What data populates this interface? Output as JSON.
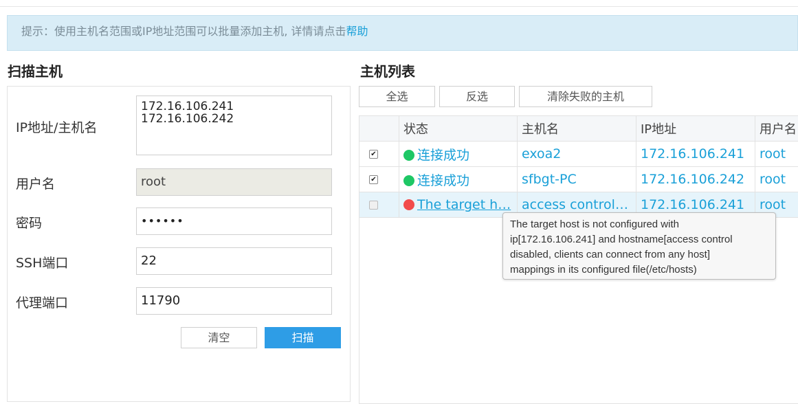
{
  "tip": {
    "text": "提示：使用主机名范围或IP地址范围可以批量添加主机, 详情请点击",
    "link": "帮助"
  },
  "scan": {
    "title": "扫描主机",
    "ip_label": "IP地址/主机名",
    "ip_value": "172.16.106.241\n172.16.106.242",
    "user_label": "用户名",
    "user_value": "root",
    "password_label": "密码",
    "password_value": "••••••",
    "ssh_label": "SSH端口",
    "ssh_value": "22",
    "proxy_label": "代理端口",
    "proxy_value": "11790",
    "clear_button": "清空",
    "scan_button": "扫描"
  },
  "hostlist": {
    "title": "主机列表",
    "select_all": "全选",
    "invert": "反选",
    "clear_failed": "清除失败的主机",
    "columns": [
      "状态",
      "主机名",
      "IP地址",
      "用户名"
    ],
    "rows": [
      {
        "checked": true,
        "status": "连接成功",
        "status_color": "#1ec765",
        "hostname": "exoa2",
        "ip": "172.16.106.241",
        "user": "root"
      },
      {
        "checked": true,
        "status": "连接成功",
        "status_color": "#1ec765",
        "hostname": "sfbgt-PC",
        "ip": "172.16.106.242",
        "user": "root"
      },
      {
        "checked": false,
        "status": "The target h…",
        "status_color": "#f24b4b",
        "hostname": "access control …",
        "ip": "172.16.106.241",
        "user": "root"
      }
    ]
  },
  "tooltip": {
    "line1": "The target host is not configured with",
    "line2": "ip[172.16.106.241] and hostname[access control",
    "line3": "disabled, clients can connect from any host]",
    "line4": "mappings in its configured file(/etc/hosts)"
  }
}
